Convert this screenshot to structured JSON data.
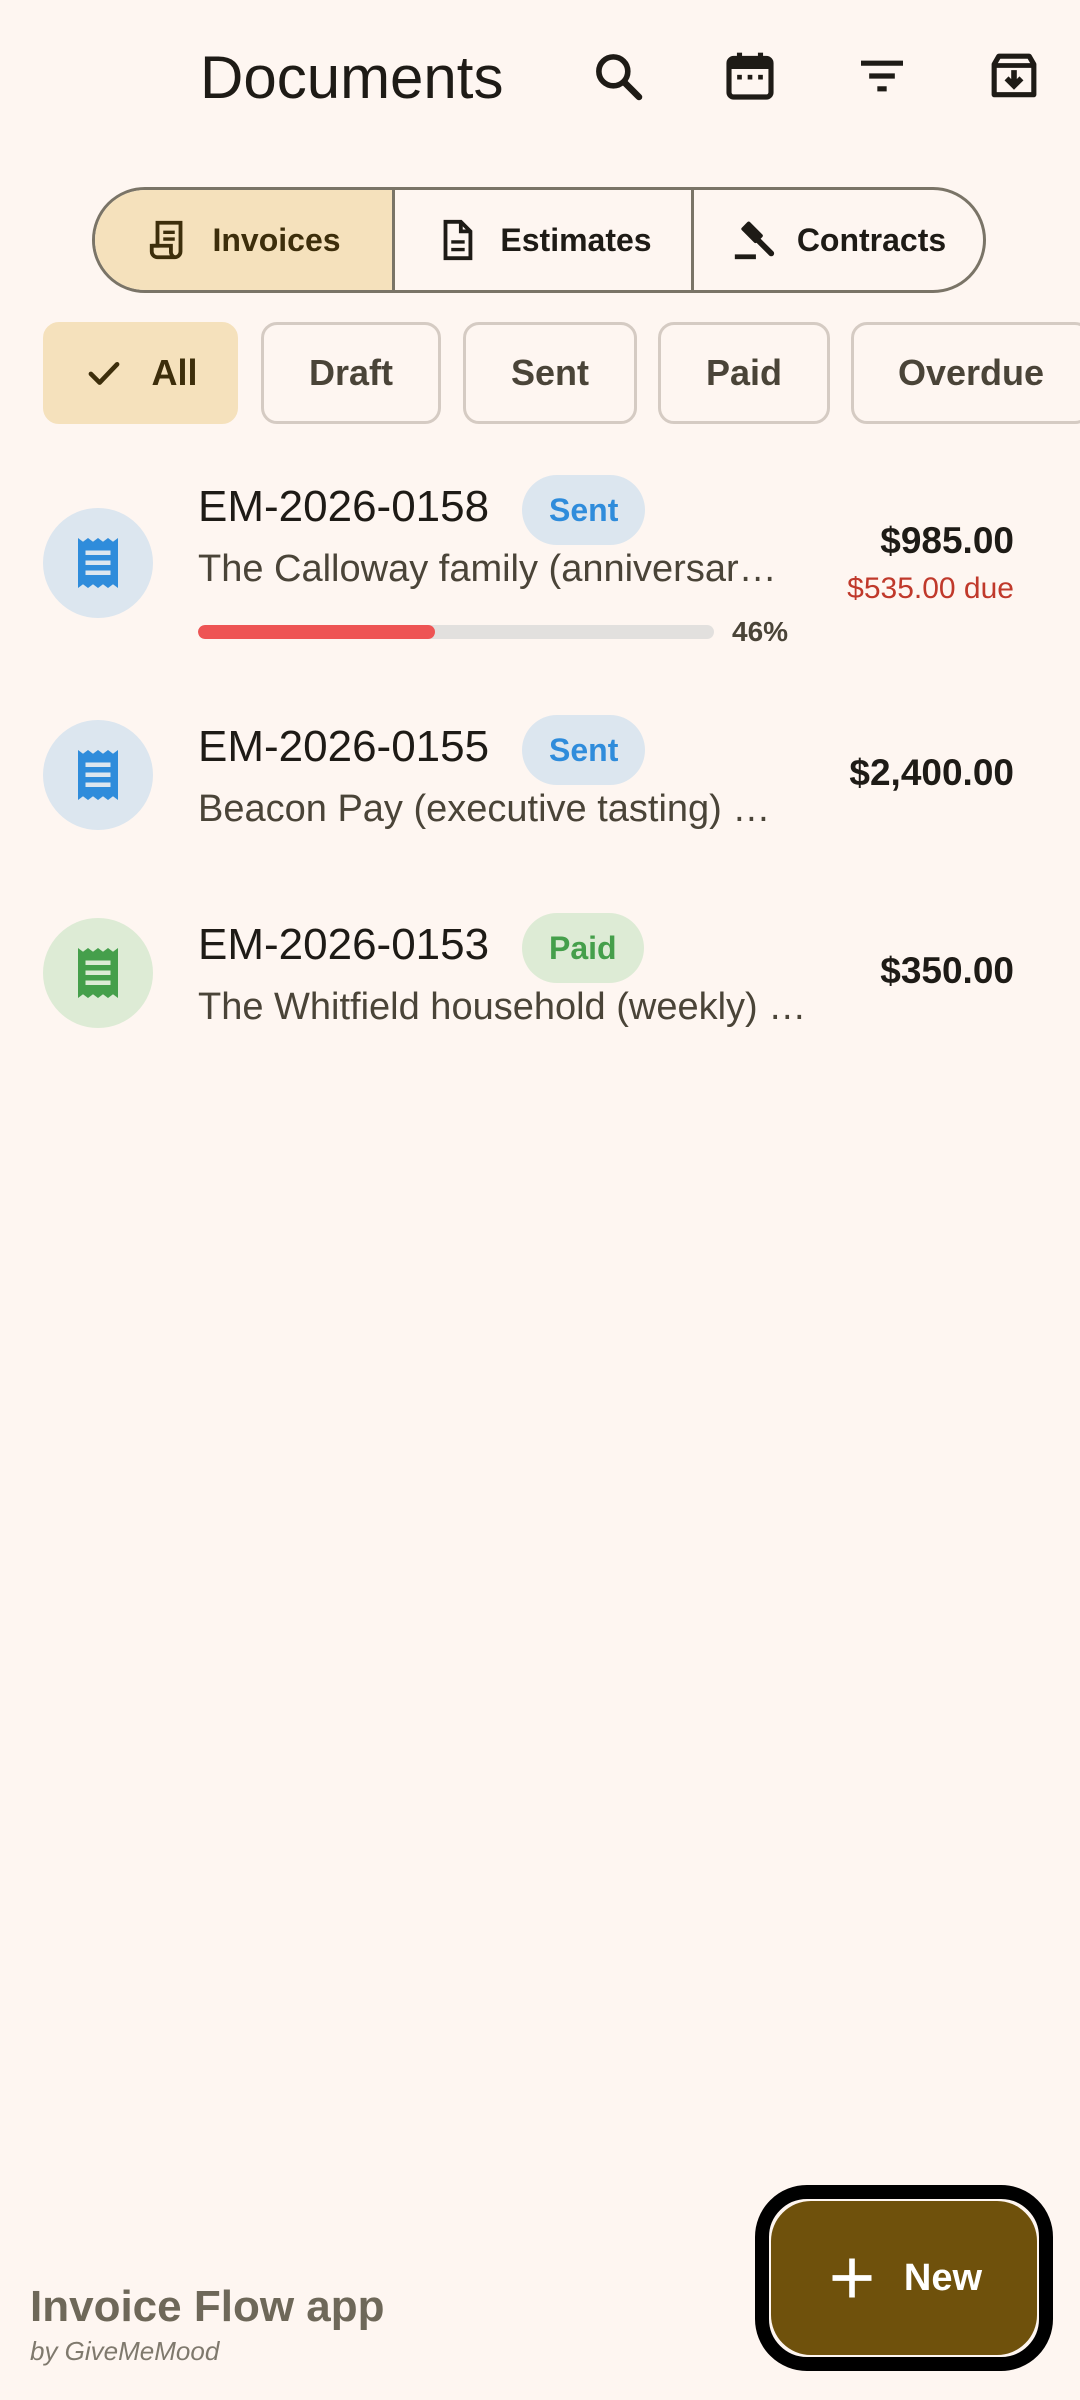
{
  "header": {
    "title": "Documents",
    "icons": [
      "search-icon",
      "calendar-icon",
      "filter-icon",
      "archive-icon"
    ]
  },
  "segments": [
    {
      "label": "Invoices",
      "icon": "receipt-icon",
      "selected": true
    },
    {
      "label": "Estimates",
      "icon": "document-icon",
      "selected": false
    },
    {
      "label": "Contracts",
      "icon": "gavel-icon",
      "selected": false
    }
  ],
  "filters": [
    {
      "label": "All",
      "selected": true
    },
    {
      "label": "Draft",
      "selected": false
    },
    {
      "label": "Sent",
      "selected": false
    },
    {
      "label": "Paid",
      "selected": false
    },
    {
      "label": "Overdue",
      "selected": false
    }
  ],
  "invoices": [
    {
      "number": "EM-2026-0158",
      "status": "Sent",
      "description": "The Calloway family (anniversary dinner)",
      "amount": "$985.00",
      "due": "$535.00 due",
      "progress_percent": 46,
      "progress_label": "46%",
      "status_color": "#2F8CDB"
    },
    {
      "number": "EM-2026-0155",
      "status": "Sent",
      "description": "Beacon Pay (executive tasting) catering",
      "amount": "$2,400.00",
      "status_color": "#2F8CDB"
    },
    {
      "number": "EM-2026-0153",
      "status": "Paid",
      "description": "The Whitfield household (weekly) meal prep",
      "amount": "$350.00",
      "status_color": "#459F4B"
    }
  ],
  "fab": {
    "label": "New",
    "icon": "plus-icon"
  },
  "footer": {
    "brand": "Invoice Flow app",
    "byline": "by GiveMeMood"
  },
  "colors": {
    "background": "#FEF6F1",
    "selected_chip": "#F5E1BC",
    "fab": "#6F510C",
    "due": "#C0392B",
    "progress": "#EE5454"
  }
}
